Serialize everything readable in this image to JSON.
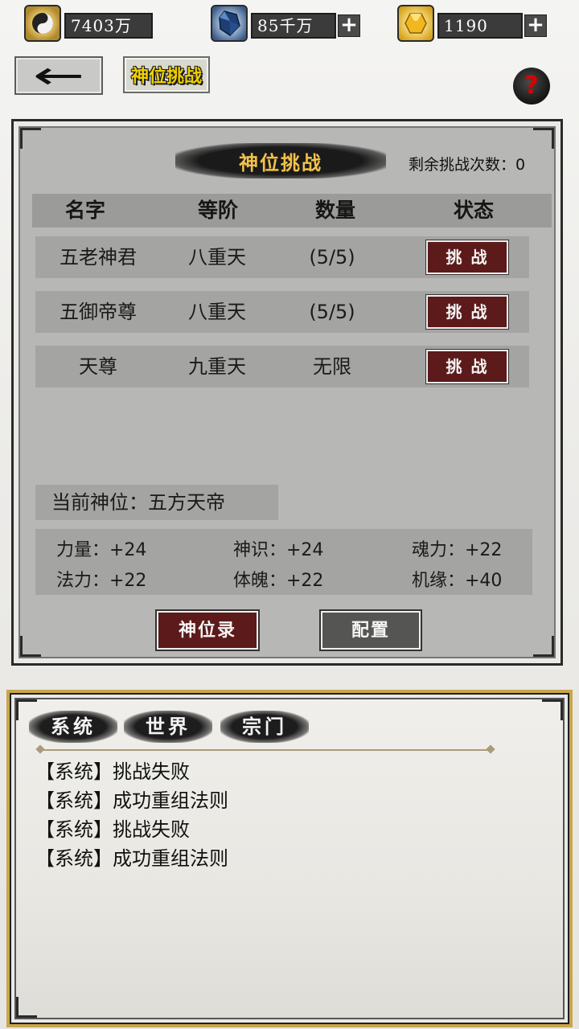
{
  "resources": [
    {
      "icon": "yin-yang-coin-icon",
      "value": "7403万",
      "has_plus": false
    },
    {
      "icon": "blue-crystal-icon",
      "value": "85千万",
      "has_plus": true
    },
    {
      "icon": "gold-ingot-icon",
      "value": "1190",
      "has_plus": true
    }
  ],
  "nav": {
    "back_icon": "left-arrow-icon",
    "title_tab": "神位挑战",
    "help_symbol": "?"
  },
  "panel": {
    "title": "神位挑战",
    "remaining": "剩余挑战次数：0",
    "columns": [
      "名字",
      "等阶",
      "数量",
      "状态"
    ],
    "rows": [
      {
        "name": "五老神君",
        "rank": "八重天",
        "count": "(5/5)",
        "action": "挑 战"
      },
      {
        "name": "五御帝尊",
        "rank": "八重天",
        "count": "(5/5)",
        "action": "挑 战"
      },
      {
        "name": "天尊",
        "rank": "九重天",
        "count": "无限",
        "action": "挑 战"
      }
    ],
    "current_position": "当前神位：五方天帝",
    "stats": [
      "力量：+24",
      "神识：+24",
      "魂力：+22",
      "法力：+22",
      "体魄：+22",
      "机缘：+40"
    ],
    "record_button": "神位录",
    "config_button": "配置"
  },
  "chat": {
    "tabs": [
      "系统",
      "世界",
      "宗门"
    ],
    "messages": [
      "【系统】挑战失败",
      "【系统】成功重组法则",
      "【系统】挑战失败",
      "【系统】成功重组法则"
    ]
  },
  "colors": {
    "accent_red": "#5c1a1a",
    "gold_title": "#f2c14a",
    "panel_gray": "#b7b7b5",
    "chat_border_gold": "#c8a64a"
  }
}
